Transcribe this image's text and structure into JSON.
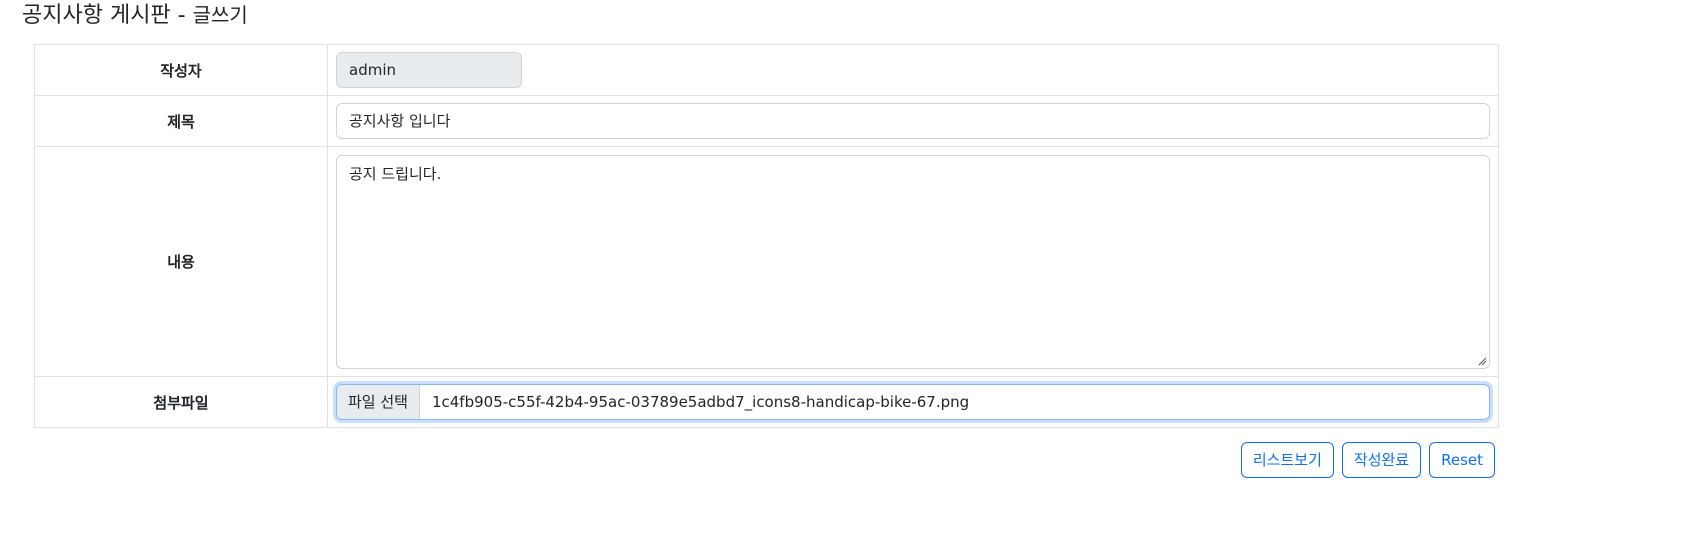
{
  "page": {
    "title": "공지사항 게시판 - ",
    "subtitle": "글쓰기"
  },
  "form": {
    "rows": [
      {
        "label": "작성자",
        "value": "admin"
      },
      {
        "label": "제목",
        "value": "공지사항 입니다"
      },
      {
        "label": "내용",
        "value": "공지 드립니다."
      },
      {
        "label": "첨부파일",
        "button": "파일 선택",
        "value": "1c4fb905-c55f-42b4-95ac-03789e5adbd7_icons8-handicap-bike-67.png"
      }
    ]
  },
  "actions": {
    "list": "리스트보기",
    "submit": "작성완료",
    "reset": "Reset"
  },
  "colors": {
    "accent": "#0d6efd",
    "border": "#dee2e6",
    "readonly_bg": "#e9ecef"
  }
}
